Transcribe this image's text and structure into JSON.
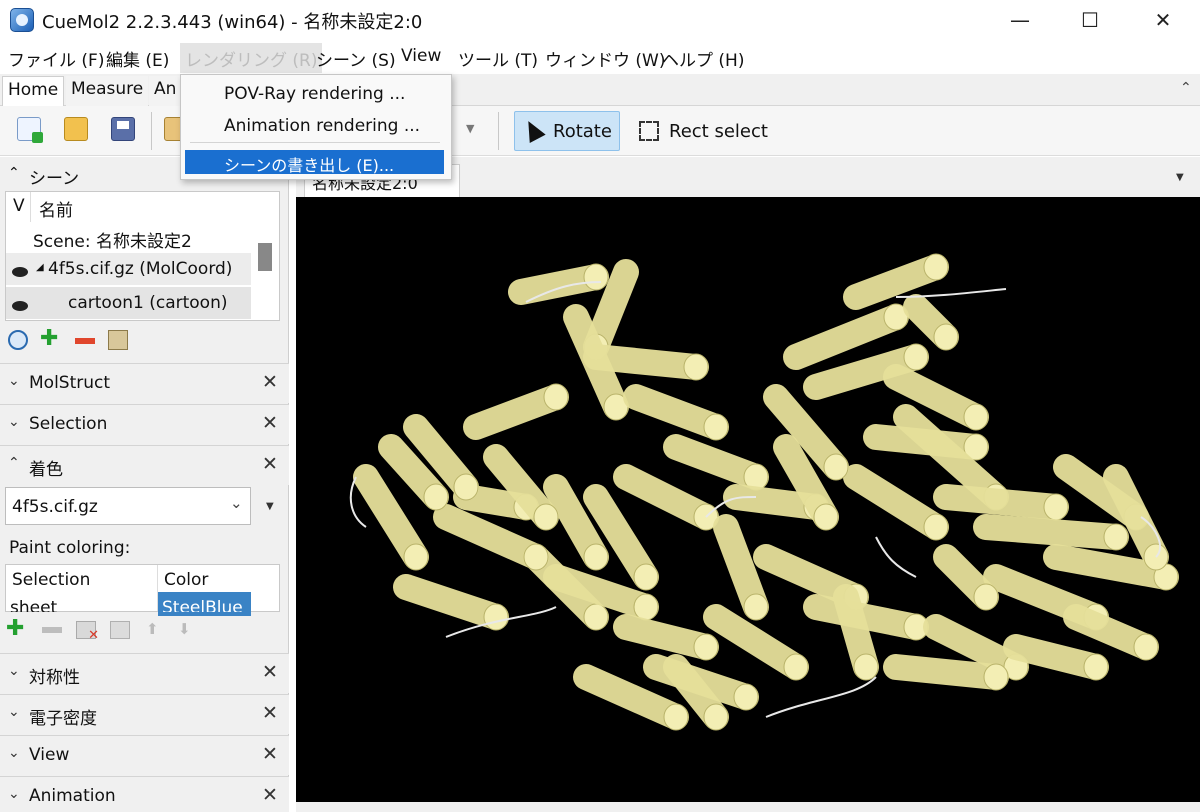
{
  "window": {
    "title": "CueMol2 2.2.3.443 (win64) - 名称未設定2:0",
    "controls": [
      "minimize-icon",
      "maximize-icon",
      "close-icon"
    ]
  },
  "menubar": [
    "ファイル (F)",
    "編集 (E)",
    "レンダリング (R)",
    "シーン (S)",
    "View",
    "ツール (T)",
    "ウィンドウ (W)",
    "ヘルプ (H)"
  ],
  "tabs": [
    "Home",
    "Measure",
    "An"
  ],
  "toolbar": {
    "icons": [
      "new-file-icon",
      "open-folder-icon",
      "save-icon",
      "render-icon",
      "dropdown-arrow-icon"
    ],
    "rotate_label": "Rotate",
    "rect_select_label": "Rect select"
  },
  "dropdown": {
    "items": [
      "POV-Ray rendering ...",
      "Animation rendering ...",
      "シーンの書き出し (E)..."
    ],
    "highlighted_index": 2
  },
  "scene_panel": {
    "title": "シーン",
    "columns": [
      "V",
      "名前"
    ],
    "rows": [
      "Scene: 名称未設定2",
      "4f5s.cif.gz (MolCoord)",
      "cartoon1 (cartoon)"
    ]
  },
  "sections": [
    "MolStruct",
    "Selection",
    "着色",
    "対称性",
    "電子密度",
    "View",
    "Animation"
  ],
  "coloring": {
    "selected_object": "4f5s.cif.gz",
    "paint_label": "Paint coloring:",
    "columns": [
      "Selection",
      "Color"
    ],
    "rows": [
      {
        "selection": "sheet",
        "color": "SteelBlue"
      }
    ]
  },
  "viewer": {
    "tab_label": "名称未設定2:0"
  },
  "colors": {
    "accent": "#1a6fd0",
    "rotate_bg": "#cce4f7",
    "cylinder": "#e6e09a",
    "viewer_bg": "#000000",
    "steelblue_cell": "#3a83c5"
  }
}
